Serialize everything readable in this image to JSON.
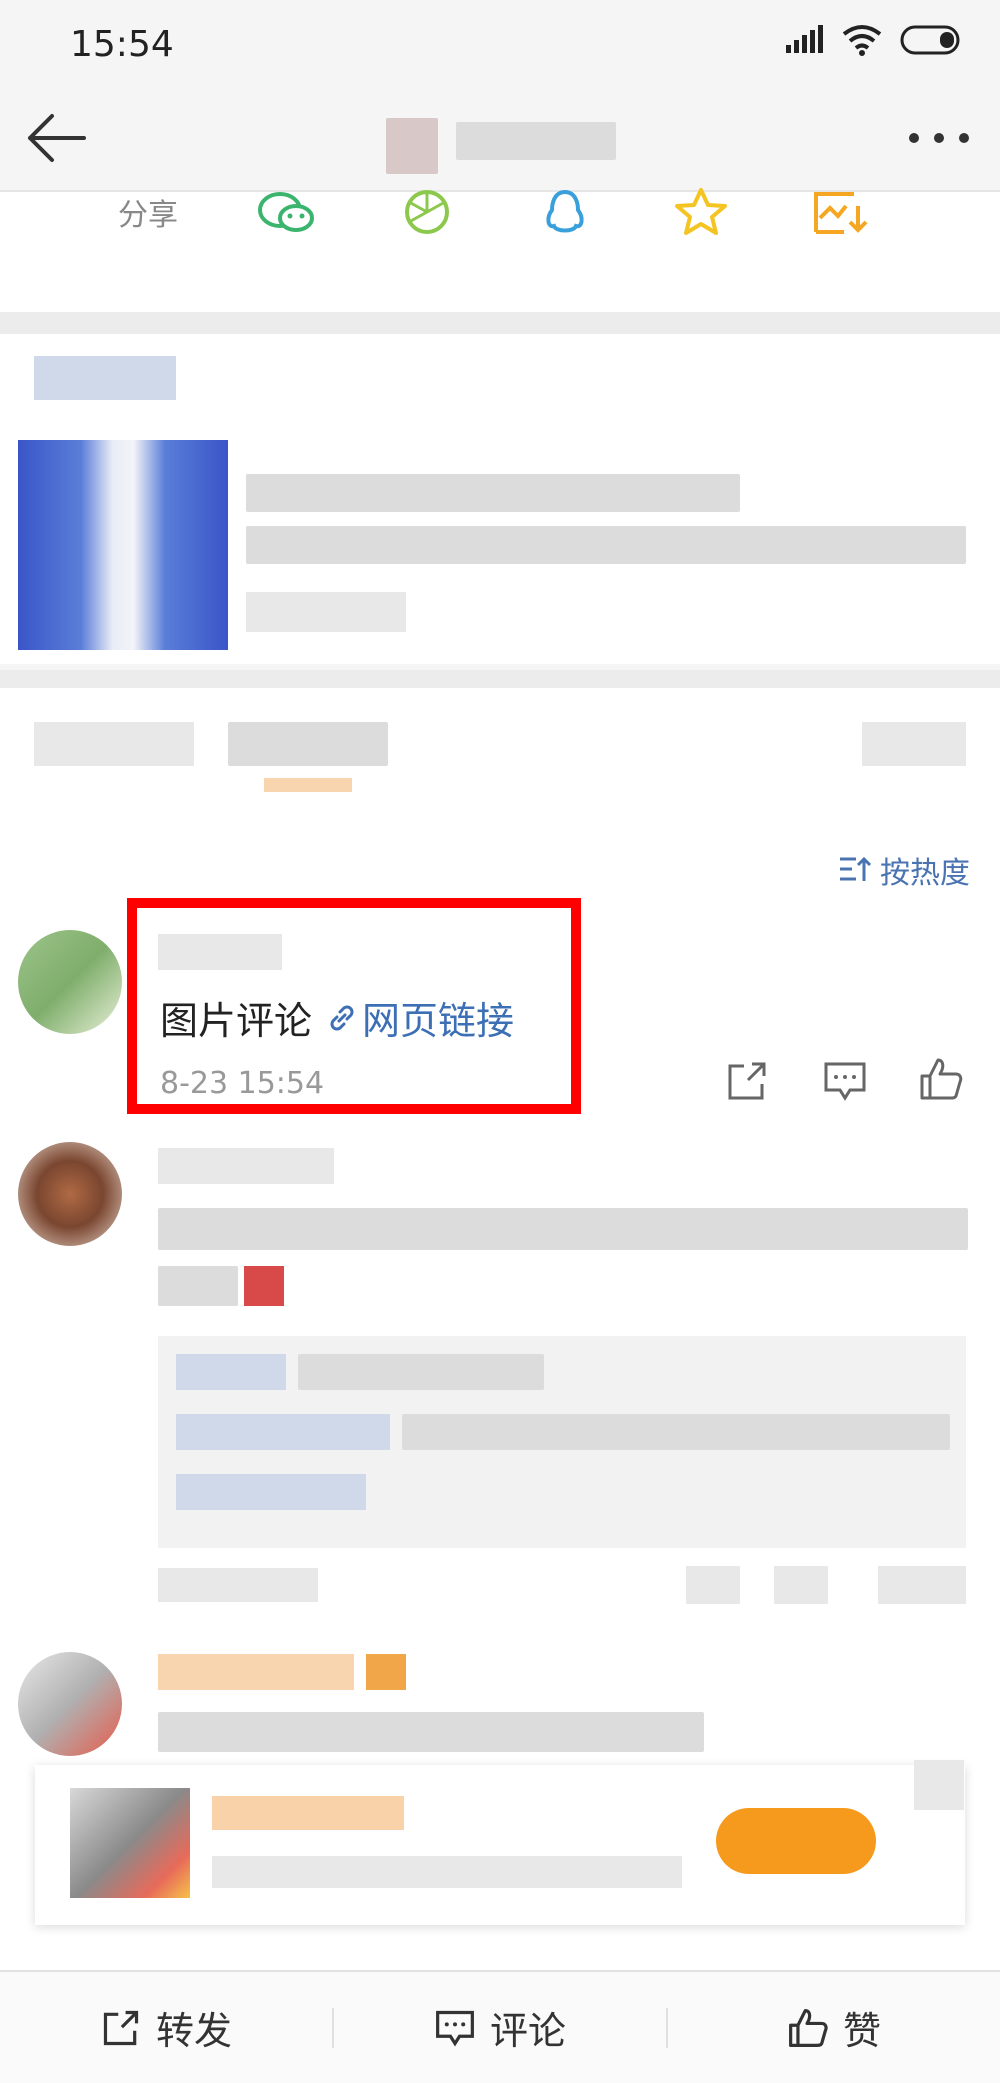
{
  "status": {
    "time": "15:54"
  },
  "share": {
    "label": "分享"
  },
  "sort": {
    "label": "按热度"
  },
  "comment": {
    "text": "图片评论",
    "link_label": "网页链接",
    "time": "8-23 15:54"
  },
  "bottom_bar": {
    "repost": "转发",
    "comment": "评论",
    "like": "赞"
  },
  "colors": {
    "accent_blue": "#4a73b2",
    "highlight_red": "#ff0000",
    "wechat_green": "#3bb46e",
    "moments_green": "#8cc84b",
    "qq_blue": "#3aa0dc",
    "star_yellow": "#f3c422",
    "album_orange": "#f5a623"
  }
}
